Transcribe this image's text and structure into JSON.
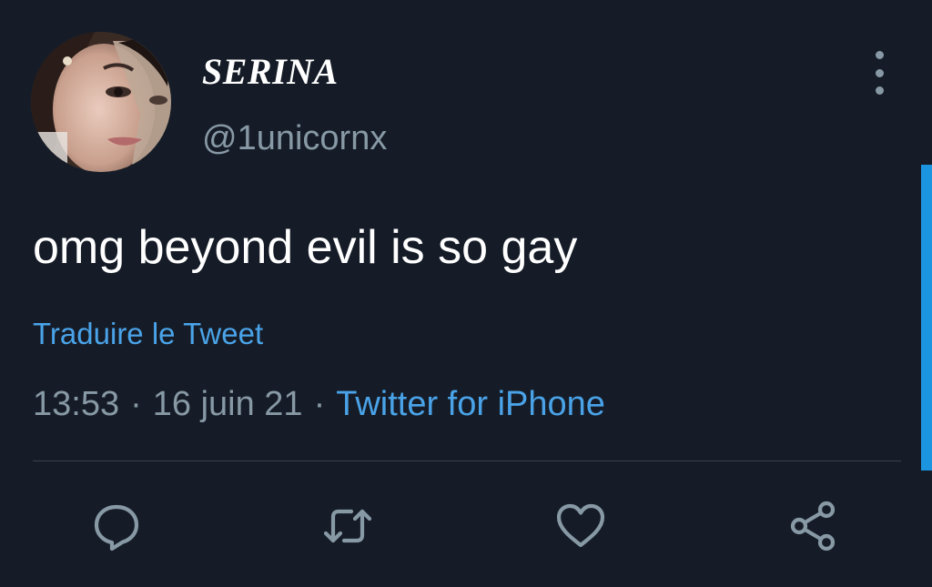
{
  "tweet": {
    "display_name": "SERINA",
    "handle": "@1unicornx",
    "text": "omg beyond evil is so gay",
    "translate_label": "Traduire le Tweet",
    "time": "13:53",
    "separator": "·",
    "date": "16 juin 21",
    "source": "Twitter for iPhone"
  },
  "icons": {
    "more": "more-vertical-icon",
    "reply": "reply-icon",
    "retweet": "retweet-icon",
    "like": "heart-icon",
    "share": "share-icon"
  },
  "colors": {
    "background": "#151c27",
    "text_primary": "#ffffff",
    "text_secondary": "#8899a6",
    "link": "#4aa3e8",
    "accent": "#1b95e0",
    "divider": "#38444d"
  }
}
